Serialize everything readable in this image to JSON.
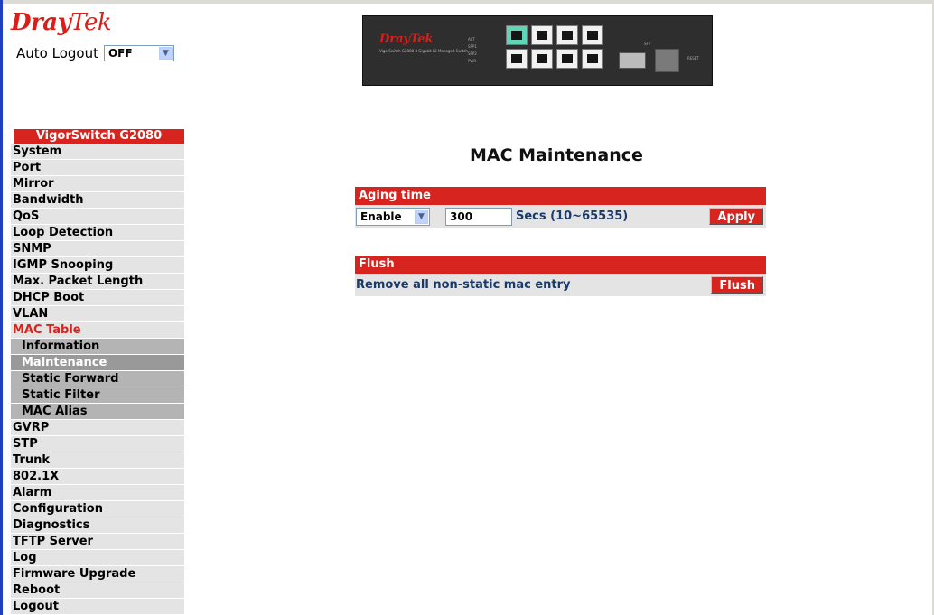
{
  "brand": {
    "name_bold": "Dray",
    "name_rest": "Tek"
  },
  "auto_logout": {
    "label": "Auto Logout",
    "value": "OFF"
  },
  "device": {
    "logo": "DrayTek",
    "subtitle": "VigorSwitch G2080 8 Gigabit L2 Managed Switch",
    "leds": [
      "ACT",
      "SFP1",
      "SFP2",
      "PWR"
    ],
    "sfp_label": "SFP",
    "reset_label": "RESET"
  },
  "sidebar": {
    "title": "VigorSwitch G2080",
    "items_top": [
      "System",
      "Port",
      "Mirror",
      "Bandwidth",
      "QoS",
      "Loop Detection",
      "SNMP",
      "IGMP Snooping",
      "Max. Packet Length",
      "DHCP Boot",
      "VLAN"
    ],
    "active_group": "MAC Table",
    "sub_items": [
      "Information",
      "Maintenance",
      "Static Forward",
      "Static Filter",
      "MAC Alias"
    ],
    "active_sub": "Maintenance",
    "items_bottom": [
      "GVRP",
      "STP",
      "Trunk",
      "802.1X",
      "Alarm",
      "Configuration",
      "Diagnostics",
      "TFTP Server",
      "Log",
      "Firmware Upgrade",
      "Reboot",
      "Logout"
    ]
  },
  "main": {
    "title": "MAC Maintenance",
    "aging": {
      "header": "Aging time",
      "mode": "Enable",
      "value": "300",
      "range_text": "Secs  (10~65535)",
      "apply_label": "Apply"
    },
    "flush": {
      "header": "Flush",
      "description": "Remove all non-static mac entry",
      "button_label": "Flush"
    }
  },
  "colors": {
    "accent": "#d8241e",
    "menu_bg": "#e4e4e4",
    "submenu_bg": "#b4b4b4"
  }
}
